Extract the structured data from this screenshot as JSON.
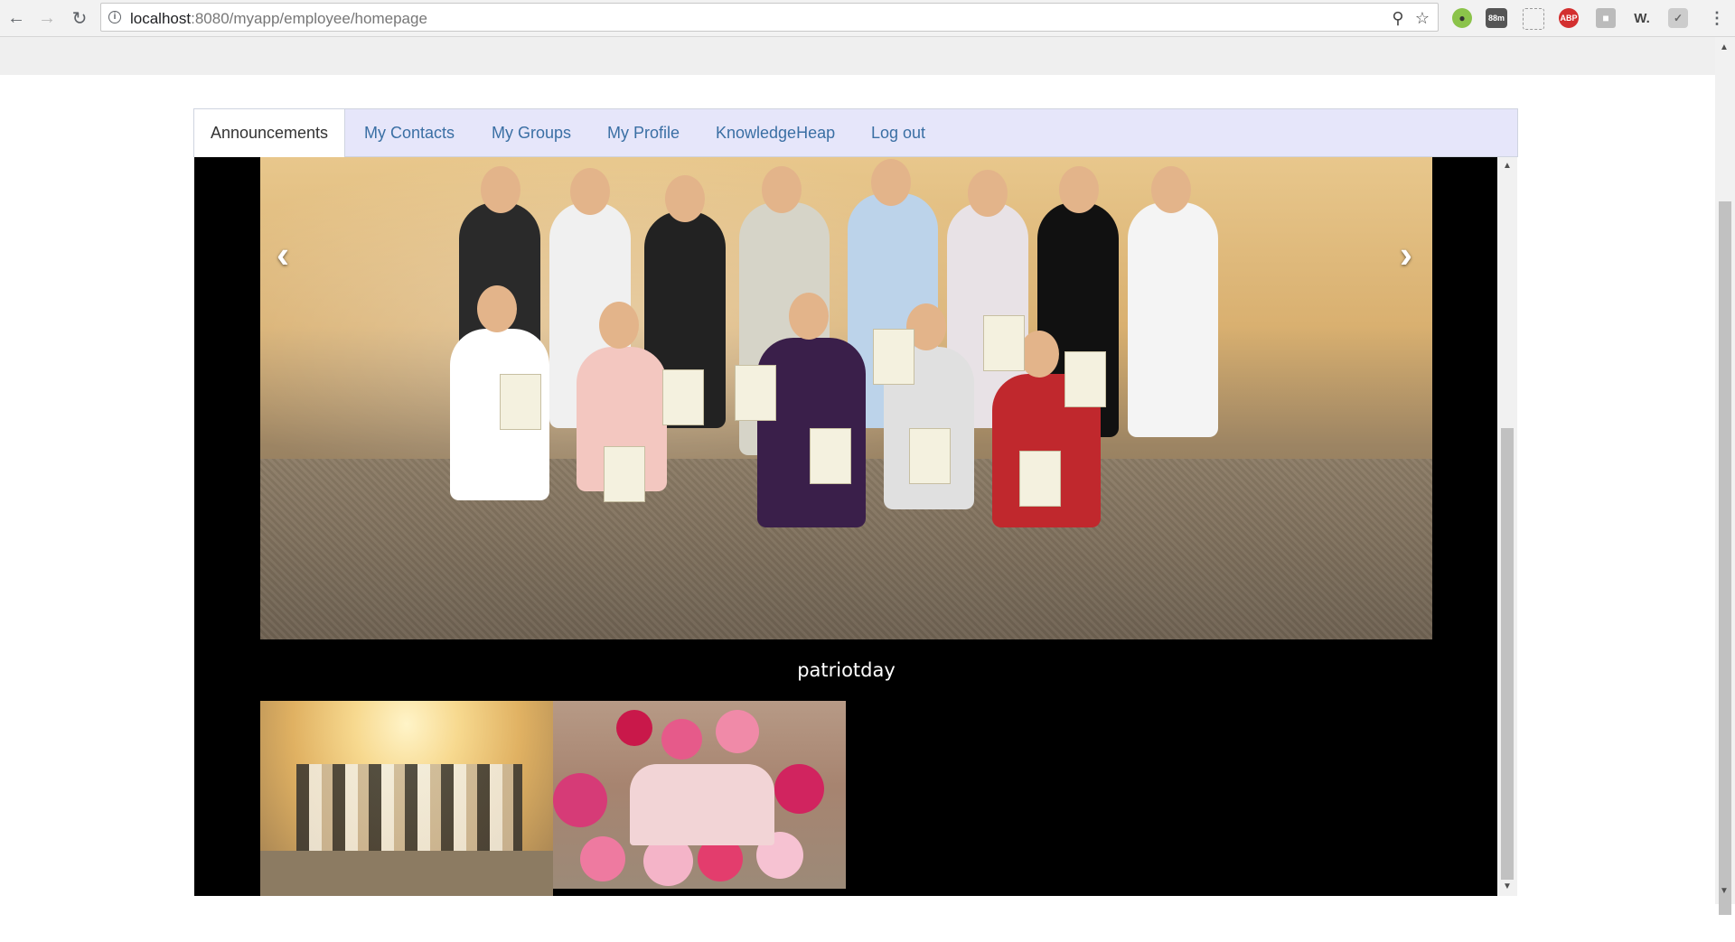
{
  "browser": {
    "url_host": "localhost",
    "url_rest": ":8080/myapp/employee/homepage",
    "extension_badge": "88m",
    "extension_abp": "ABP",
    "extension_w": "W."
  },
  "nav": {
    "tabs": [
      {
        "label": "Announcements",
        "active": true
      },
      {
        "label": "My Contacts"
      },
      {
        "label": "My Groups"
      },
      {
        "label": "My Profile"
      },
      {
        "label": "KnowledgeHeap"
      },
      {
        "label": "Log out"
      }
    ]
  },
  "gallery": {
    "caption": "patriotday",
    "prev_icon": "‹",
    "next_icon": "›"
  },
  "colors": {
    "tab_bar_bg": "#e6e6fa",
    "tab_link": "#3a6fa4",
    "viewer_bg": "#000000"
  }
}
